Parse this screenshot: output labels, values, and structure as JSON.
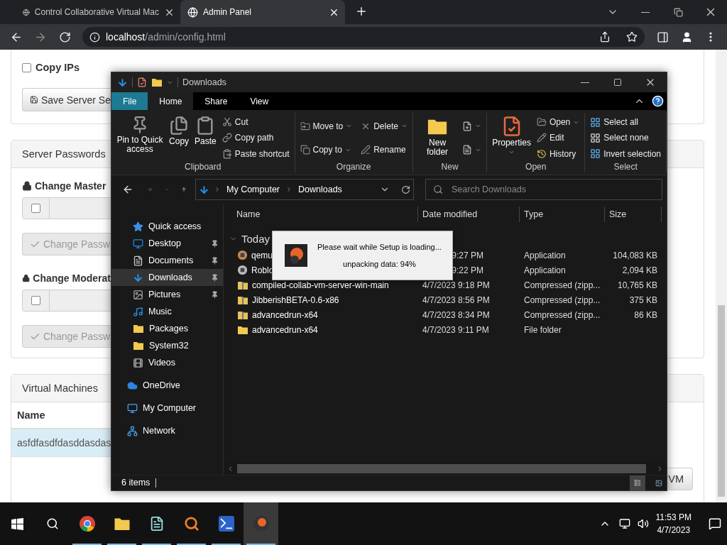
{
  "browser": {
    "tabs": [
      {
        "title": "Control Collaborative Virtual Mac",
        "selected": false
      },
      {
        "title": "Admin Panel",
        "selected": true
      }
    ],
    "url": {
      "host": "localhost",
      "path": "/admin/config.html"
    }
  },
  "page": {
    "settings": {
      "checkbox": {
        "label": "Copy IPs",
        "checked": false
      },
      "save_button": "Save Server Se"
    },
    "passwords": {
      "title": "Server Passwords",
      "sections": [
        {
          "title": "Change Master ",
          "checked": false,
          "button": "Change Passw"
        },
        {
          "title": "Change Moderat",
          "checked": false,
          "button": "Change Passw"
        }
      ]
    },
    "vms": {
      "title": "Virtual Machines",
      "column": "Name",
      "rows": [
        {
          "name": "asfdfasdfdasddasdas",
          "selected": true
        }
      ],
      "button": "VM"
    }
  },
  "explorer": {
    "title": "Downloads",
    "ribbon_tabs": [
      {
        "label": "File",
        "kind": "file",
        "selected": false
      },
      {
        "label": "Home",
        "kind": "tab",
        "selected": true
      },
      {
        "label": "Share",
        "kind": "tab",
        "selected": false
      },
      {
        "label": "View",
        "kind": "tab",
        "selected": false
      }
    ],
    "ribbon_groups": [
      {
        "label": "Clipboard",
        "large": [
          {
            "label": "Pin to Quick access",
            "dropdown": false
          },
          {
            "label": "Copy",
            "dropdown": false
          },
          {
            "label": "Paste",
            "dropdown": false
          }
        ],
        "small": [
          {
            "label": "Cut",
            "dropdown": false
          },
          {
            "label": "Copy path",
            "dropdown": false
          },
          {
            "label": "Paste shortcut",
            "dropdown": false
          }
        ]
      },
      {
        "label": "Organize",
        "small": [
          {
            "label": "Move to",
            "dropdown": true
          },
          {
            "label": "Copy to",
            "dropdown": true
          },
          {
            "label": "Delete",
            "dropdown": true
          },
          {
            "label": "Rename",
            "dropdown": false
          }
        ]
      },
      {
        "label": "New",
        "large": [
          {
            "label": "New folder",
            "dropdown": false
          }
        ]
      },
      {
        "label": "Open",
        "large": [
          {
            "label": "Properties",
            "dropdown": true
          }
        ],
        "small": [
          {
            "label": "Open",
            "dropdown": true
          },
          {
            "label": "Edit",
            "dropdown": false
          },
          {
            "label": "History",
            "dropdown": false
          }
        ]
      },
      {
        "label": "Select",
        "small": [
          {
            "label": "Select all",
            "dropdown": false
          },
          {
            "label": "Select none",
            "dropdown": false
          },
          {
            "label": "Invert selection",
            "dropdown": false
          }
        ]
      }
    ],
    "breadcrumb": [
      "My Computer",
      "Downloads"
    ],
    "search": {
      "placeholder": "Search Downloads"
    },
    "nav": [
      {
        "label": "Quick access",
        "kind": "star",
        "selected": false,
        "children": [
          {
            "label": "Desktop",
            "kind": "desktop",
            "pinned": true,
            "selected": false
          },
          {
            "label": "Documents",
            "kind": "documents",
            "pinned": true,
            "selected": false
          },
          {
            "label": "Downloads",
            "kind": "downloads",
            "pinned": true,
            "selected": true
          },
          {
            "label": "Pictures",
            "kind": "pictures",
            "pinned": true,
            "selected": false
          },
          {
            "label": "Music",
            "kind": "music",
            "pinned": false,
            "selected": false
          },
          {
            "label": "Packages",
            "kind": "folder",
            "pinned": false,
            "selected": false
          },
          {
            "label": "System32",
            "kind": "folder",
            "pinned": false,
            "selected": false
          },
          {
            "label": "Videos",
            "kind": "videos",
            "pinned": false,
            "selected": false
          }
        ]
      },
      {
        "label": "OneDrive",
        "kind": "cloud",
        "selected": false
      },
      {
        "label": "My Computer",
        "kind": "computer",
        "selected": false
      },
      {
        "label": "Network",
        "kind": "network",
        "selected": false
      }
    ],
    "columns": [
      "Name",
      "Date modified",
      "Type",
      "Size"
    ],
    "group": "Today",
    "files": [
      {
        "kind": "app",
        "name": "qemu",
        "date": "9:27 PM",
        "type": "Application",
        "size": "104,083 KB"
      },
      {
        "kind": "app",
        "name": "Roblo",
        "date": "9:22 PM",
        "type": "Application",
        "size": "2,094 KB"
      },
      {
        "kind": "zip",
        "name": "compiled-collab-vm-server-win-main",
        "date": "4/7/2023 9:18 PM",
        "type": "Compressed (zipp...",
        "size": "10,765 KB"
      },
      {
        "kind": "zip",
        "name": "JibberishBETA-0.6-x86",
        "date": "4/7/2023 8:56 PM",
        "type": "Compressed (zipp...",
        "size": "375 KB"
      },
      {
        "kind": "zip",
        "name": "advancedrun-x64",
        "date": "4/7/2023 8:34 PM",
        "type": "Compressed (zipp...",
        "size": "86 KB"
      },
      {
        "kind": "folder",
        "name": "advancedrun-x64",
        "date": "4/7/2023 9:11 PM",
        "type": "File folder"
      }
    ],
    "status": "6 items",
    "views": [
      {
        "kind": "details",
        "selected": true
      },
      {
        "kind": "icons",
        "selected": false
      }
    ]
  },
  "dialog": {
    "message": "Please wait while Setup is loading...",
    "progress": "unpacking data: 94%"
  },
  "taskbar": {
    "apps": [
      {
        "kind": "start",
        "running": false,
        "active": false
      },
      {
        "kind": "search",
        "running": false,
        "active": false
      },
      {
        "kind": "chrome",
        "running": true,
        "active": false
      },
      {
        "kind": "explorer",
        "running": true,
        "active": false
      },
      {
        "kind": "notepad",
        "running": true,
        "active": false
      },
      {
        "kind": "magnifier",
        "running": true,
        "active": false
      },
      {
        "kind": "terminal",
        "running": true,
        "active": false
      },
      {
        "kind": "setup",
        "running": true,
        "active": true
      }
    ],
    "time": "11:53 PM",
    "date": "4/7/2023"
  }
}
